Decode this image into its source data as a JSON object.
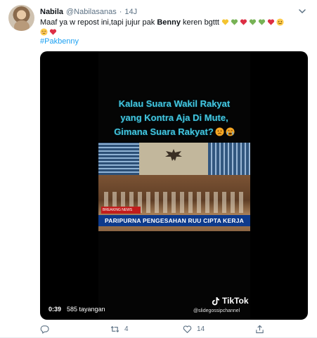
{
  "tweet": {
    "author_name": "Nabila",
    "author_handle": "@Nabilasanas",
    "separator": "·",
    "time": "14J",
    "text_part1": "Maaf ya w repost ini,tapi jujur pak ",
    "text_bold": "Benny",
    "text_part2": " keren bgttt ",
    "emoji_sequence": [
      "yellow-heart",
      "green-heart",
      "red-heart",
      "green-heart",
      "green-heart",
      "red-heart",
      "smiling-face",
      "smiling-face",
      "red-heart"
    ],
    "hashtag": "#Pakbenny"
  },
  "video": {
    "caption_line1": "Kalau Suara Wakil Rakyat",
    "caption_line2": "yang Kontra Aja Di Mute,",
    "caption_line3": "Gimana Suara Rakyat?",
    "news_tag": "BREAKING NEWS",
    "lower_third": "PARIPURNA PENGESAHAN RUU CIPTA KERJA",
    "watermark": "TikTok",
    "watermark_user": "@slidegossipchannel",
    "duration": "0:39",
    "views": "585 tayangan",
    "caption_color": "#43c6e0"
  },
  "actions": {
    "reply_count": "",
    "retweet_count": "4",
    "like_count": "14",
    "share_count": ""
  },
  "colors": {
    "accent": "#1da1f2",
    "muted": "#5b7083",
    "text": "#0f1419"
  }
}
